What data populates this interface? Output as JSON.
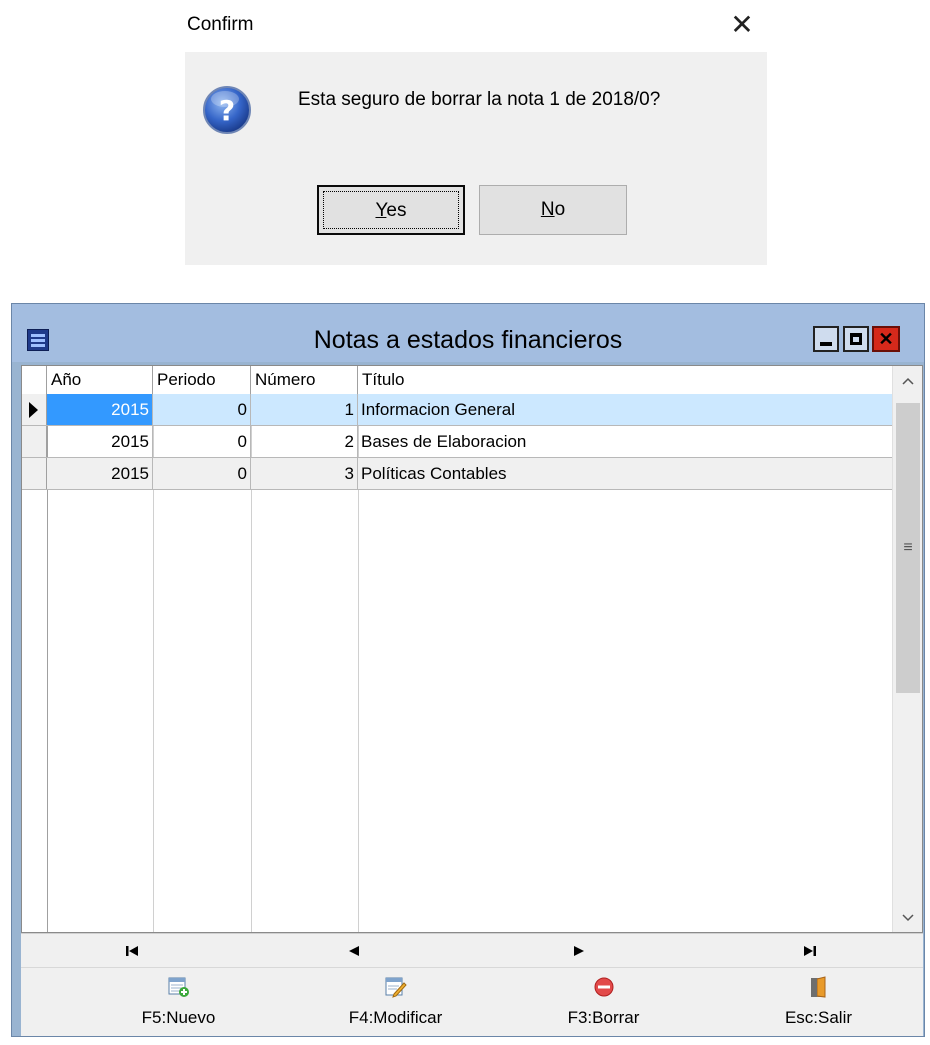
{
  "dialog": {
    "title": "Confirm",
    "close_glyph": "✕",
    "icon": "question-icon",
    "message": "Esta seguro de borrar la nota 1 de 2018/0?",
    "yes_underlined": "Y",
    "yes_rest": "es",
    "no_underlined": "N",
    "no_rest": "o"
  },
  "window": {
    "title": "Notas a estados financieros",
    "icon": "app-icon"
  },
  "grid": {
    "columns": [
      "Año",
      "Periodo",
      "Número",
      "Título"
    ],
    "rows": [
      {
        "year": "2015",
        "period": "0",
        "number": "1",
        "title": "Informacion General",
        "selected": true
      },
      {
        "year": "2015",
        "period": "0",
        "number": "2",
        "title": "Bases de Elaboracion",
        "selected": false
      },
      {
        "year": "2015",
        "period": "0",
        "number": "3",
        "title": "Políticas Contables",
        "selected": false
      }
    ]
  },
  "scrollbar": {
    "up_glyph": "^",
    "down_glyph": "v",
    "grip_glyph": "≡"
  },
  "navigator": {
    "first": "|◀",
    "prior": "◀",
    "next": "▶",
    "last": "▶|"
  },
  "toolbar": {
    "new_label": "F5:Nuevo",
    "edit_label": "F4:Modificar",
    "delete_label": "F3:Borrar",
    "exit_label": "Esc:Salir"
  },
  "colors": {
    "titlebar": "#a3bde0",
    "selection": "#3399ff",
    "selection_row": "#cce8ff",
    "close_button": "#d6291b"
  }
}
